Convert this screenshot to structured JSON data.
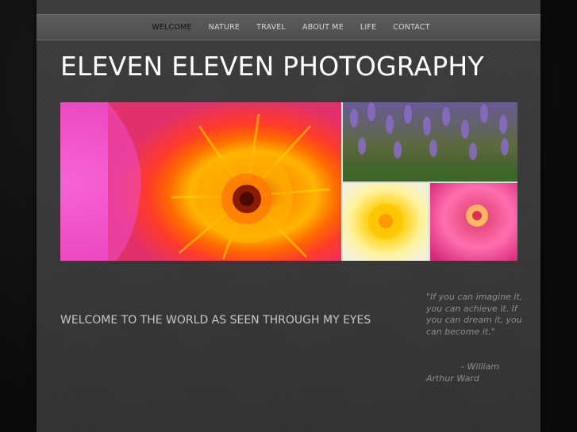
{
  "nav": {
    "items": [
      {
        "label": "WELCOME",
        "active": true
      },
      {
        "label": "NATURE",
        "active": false
      },
      {
        "label": "TRAVEL",
        "active": false
      },
      {
        "label": "ABOUT ME",
        "active": false
      },
      {
        "label": "LIFE",
        "active": false
      },
      {
        "label": "CONTACT",
        "active": false
      }
    ]
  },
  "header": {
    "title": "ELEVEN ELEVEN PHOTOGRAPHY"
  },
  "banner": {
    "photos": [
      "gazania-flower-photo",
      "lavender-field-photo",
      "yellow-lily-photo",
      "pink-dahlia-photo"
    ]
  },
  "main": {
    "welcome": "WELCOME TO THE WORLD AS SEEN THROUGH MY EYES"
  },
  "sidebar": {
    "quote": "\"If you can imagine it, you can achieve it.  If you can dream it, you can become it.\"",
    "author": "- William Arthur Ward"
  },
  "colors": {
    "background": "#0d0d0d",
    "panel": "#3a3a3a",
    "nav_bar": "#555555",
    "title": "#ffffff",
    "body_text": "#c8c8c8",
    "quote_text": "#8e8e8e"
  }
}
